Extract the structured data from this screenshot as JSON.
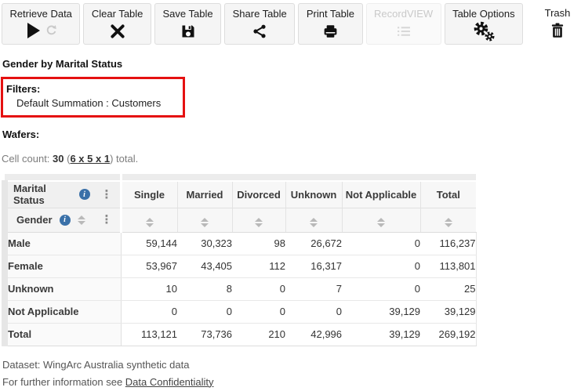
{
  "toolbar": {
    "buttons": [
      {
        "label": "Retrieve Data",
        "icons": [
          "play-icon",
          "refresh-icon"
        ],
        "enabled": true
      },
      {
        "label": "Clear Table",
        "icons": [
          "x-icon"
        ],
        "enabled": true
      },
      {
        "label": "Save Table",
        "icons": [
          "floppy-icon"
        ],
        "enabled": true
      },
      {
        "label": "Share Table",
        "icons": [
          "share-icon"
        ],
        "enabled": true
      },
      {
        "label": "Print Table",
        "icons": [
          "printer-icon"
        ],
        "enabled": true
      },
      {
        "label": "RecordVIEW",
        "icons": [
          "list-icon"
        ],
        "enabled": false
      },
      {
        "label": "Table Options",
        "icons": [
          "gears-icon"
        ],
        "enabled": true
      },
      {
        "label": "Trash",
        "icons": [
          "trash-icon"
        ],
        "enabled": true,
        "boxed": false
      }
    ]
  },
  "page": {
    "title": "Gender by Marital Status"
  },
  "filters": {
    "heading": "Filters:",
    "items": [
      "Default Summation : Customers"
    ],
    "highlight_color": "#e51111"
  },
  "wafers_label": "Wafers:",
  "cell_count": {
    "prefix": "Cell count: ",
    "count": "30",
    "open_paren": " (",
    "dims_link": "6 x 5 x 1",
    "close_paren": ") ",
    "suffix": "total."
  },
  "table": {
    "col_dimension": "Marital Status",
    "row_dimension": "Gender",
    "columns": [
      "Single",
      "Married",
      "Divorced",
      "Unknown",
      "Not Applicable",
      "Total"
    ],
    "rows": [
      {
        "label": "Male",
        "values": [
          "59,144",
          "30,323",
          "98",
          "26,672",
          "0",
          "116,237"
        ]
      },
      {
        "label": "Female",
        "values": [
          "53,967",
          "43,405",
          "112",
          "16,317",
          "0",
          "113,801"
        ]
      },
      {
        "label": "Unknown",
        "values": [
          "10",
          "8",
          "0",
          "7",
          "0",
          "25"
        ]
      },
      {
        "label": "Not Applicable",
        "values": [
          "0",
          "0",
          "0",
          "0",
          "39,129",
          "39,129"
        ]
      },
      {
        "label": "Total",
        "values": [
          "113,121",
          "73,736",
          "210",
          "42,996",
          "39,129",
          "269,192"
        ]
      }
    ]
  },
  "footer": {
    "dataset_line": "Dataset: WingArc Australia synthetic data",
    "info_prefix": "For further information see ",
    "link_text": "Data Confidentiality"
  },
  "colors": {
    "info_icon_blue": "#3a70a8",
    "button_bg": "#f5f5f5",
    "header_bg": "#f7f7f7",
    "disabled_text": "#c9c9c9"
  }
}
